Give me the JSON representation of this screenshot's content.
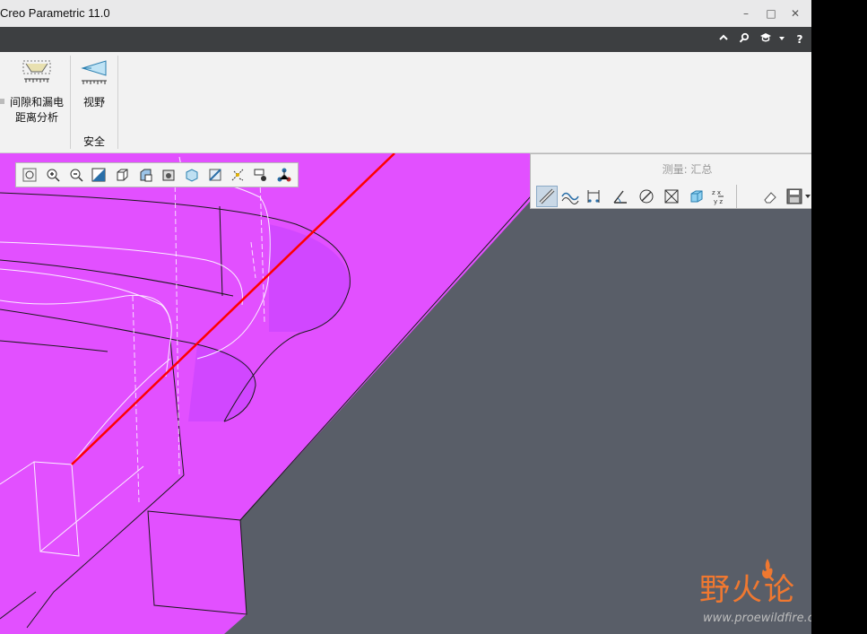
{
  "window": {
    "title": "Creo Parametric 11.0",
    "minimize": "–",
    "maximize": "□",
    "close": "✕"
  },
  "menubar": {
    "collapse_icon": "chevron-up-icon",
    "search_icon": "search-icon",
    "learning_icon": "graduation-cap-icon",
    "dropdown_icon": "chevron-down-icon",
    "help_label": "?"
  },
  "ribbon": {
    "clearance_line1": "间隙和漏电",
    "clearance_line2": "距离分析",
    "field_of_view": "视野",
    "group_safety": "安全"
  },
  "view_toolbar": {
    "icons": [
      "zoom-fit-icon",
      "zoom-in-icon",
      "zoom-out-icon",
      "repaint-icon",
      "display-style-icon",
      "saved-views-icon",
      "view-manager-icon",
      "perspective-icon",
      "section-icon",
      "datum-display-icon",
      "annotation-display-icon",
      "spin-center-icon"
    ]
  },
  "measure_panel": {
    "title": "测量: 汇总",
    "close": "✕",
    "tools": [
      "ruler-icon",
      "length-icon",
      "distance-icon",
      "angle-icon",
      "diameter-icon",
      "area-icon",
      "volume-icon",
      "transform-icon",
      "eraser-icon",
      "save-icon",
      "expand-icon"
    ]
  },
  "colors": {
    "model": "#e250ff",
    "background": "#595e68",
    "measure_line": "#ff0000"
  },
  "watermark": {
    "text": "野火论",
    "url": "www.proewildfire.cn"
  }
}
